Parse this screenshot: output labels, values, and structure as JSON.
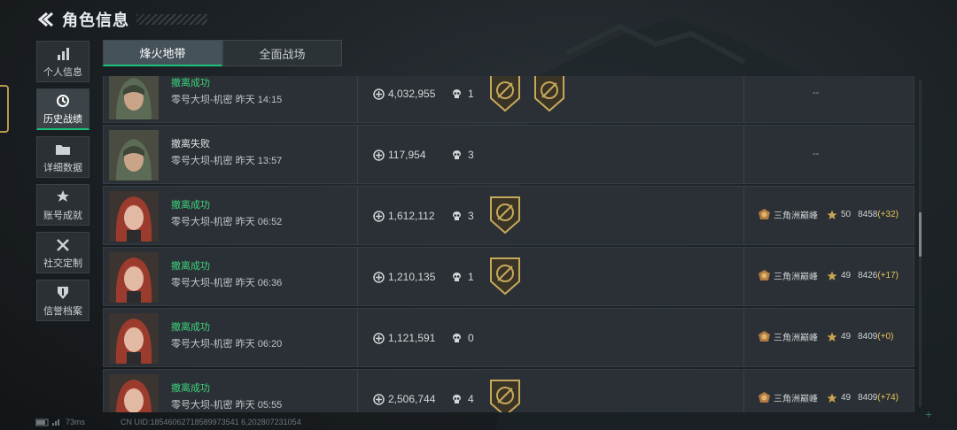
{
  "header": {
    "title": "角色信息"
  },
  "sidebar": {
    "items": [
      {
        "label": "个人信息",
        "icon": "bar-chart-icon"
      },
      {
        "label": "历史战绩",
        "icon": "clock-icon",
        "active": true
      },
      {
        "label": "详细数据",
        "icon": "folder-icon"
      },
      {
        "label": "账号成就",
        "icon": "medal-icon"
      },
      {
        "label": "社交定制",
        "icon": "crossed-tools-icon"
      },
      {
        "label": "信誉档案",
        "icon": "shield-icon"
      }
    ]
  },
  "tabs": [
    {
      "label": "烽火地带",
      "active": true
    },
    {
      "label": "全面战场",
      "active": false
    }
  ],
  "records": [
    {
      "result": "撤离成功",
      "status": "success",
      "map": "零号大坝-机密 昨天 14:15",
      "value": "4,032,955",
      "kills": "1",
      "badges": 2,
      "rank": null,
      "placeholder": "--",
      "avatar": "hooded"
    },
    {
      "result": "撤离失败",
      "status": "fail",
      "map": "零号大坝-机密 昨天 13:57",
      "value": "117,954",
      "kills": "3",
      "badges": 0,
      "rank": null,
      "placeholder": "--",
      "avatar": "hooded"
    },
    {
      "result": "撤离成功",
      "status": "success",
      "map": "零号大坝-机密 昨天 06:52",
      "value": "1,612,112",
      "kills": "3",
      "badges": 1,
      "rank": {
        "name": "三角洲巅峰",
        "level": "50",
        "score": "8458",
        "delta": "(+32)"
      },
      "avatar": "red"
    },
    {
      "result": "撤离成功",
      "status": "success",
      "map": "零号大坝-机密 昨天 06:36",
      "value": "1,210,135",
      "kills": "1",
      "badges": 1,
      "rank": {
        "name": "三角洲巅峰",
        "level": "49",
        "score": "8426",
        "delta": "(+17)"
      },
      "avatar": "red"
    },
    {
      "result": "撤离成功",
      "status": "success",
      "map": "零号大坝-机密 昨天 06:20",
      "value": "1,121,591",
      "kills": "0",
      "badges": 0,
      "rank": {
        "name": "三角洲巅峰",
        "level": "49",
        "score": "8409",
        "delta": "(+0)"
      },
      "avatar": "red"
    },
    {
      "result": "撤离成功",
      "status": "success",
      "map": "零号大坝-机密 昨天 05:55",
      "value": "2,506,744",
      "kills": "4",
      "badges": 1,
      "rank": {
        "name": "三角洲巅峰",
        "level": "49",
        "score": "8409",
        "delta": "(+74)"
      },
      "avatar": "red"
    }
  ],
  "footer": {
    "latency": "73ms",
    "uid": "CN UID:18546062718589973541 6,202807231054"
  },
  "colors": {
    "accent_green": "#19c37a",
    "success_text": "#3fd27e",
    "gold": "#b79a4f",
    "delta": "#e9c55a"
  }
}
